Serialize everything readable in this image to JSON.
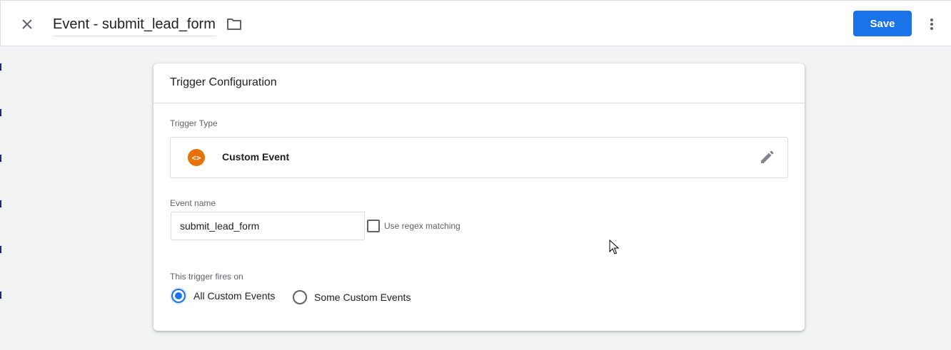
{
  "header": {
    "title": "Event - submit_lead_form",
    "save_label": "Save",
    "close_icon": "close-icon",
    "folder_icon": "folder-icon",
    "more_icon": "more-vert-icon"
  },
  "card": {
    "title": "Trigger Configuration",
    "trigger_type_label": "Trigger Type",
    "trigger_type": {
      "name": "Custom Event",
      "icon": "code-brackets-icon",
      "icon_glyph": "<>",
      "icon_color": "#e8710a"
    },
    "event_name_label": "Event name",
    "event_name_value": "submit_lead_form",
    "regex_label": "Use regex matching",
    "regex_checked": false,
    "fires_on_label": "This trigger fires on",
    "fires_on_options": [
      {
        "label": "All Custom Events",
        "selected": true
      },
      {
        "label": "Some Custom Events",
        "selected": false
      }
    ]
  },
  "colors": {
    "accent": "#1a73e8",
    "background": "#f1f3f4",
    "divider": "#dadce0"
  }
}
